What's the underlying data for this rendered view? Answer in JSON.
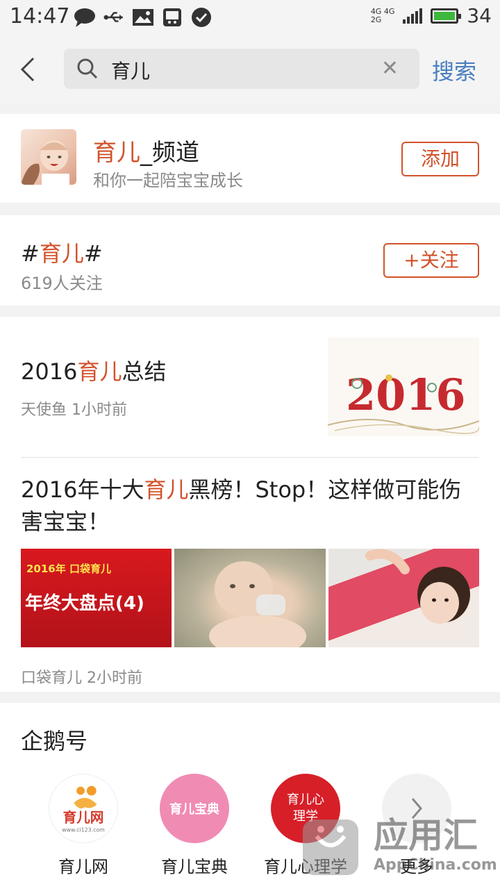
{
  "status_bar": {
    "time": "14:47",
    "net_top": "4G 4G",
    "net_bottom": "2G",
    "battery_level": "34"
  },
  "search": {
    "query": "育儿",
    "button_label": "搜索"
  },
  "channel": {
    "title_highlight": "育儿",
    "title_rest": "_频道",
    "subtitle": "和你一起陪宝宝成长",
    "add_label": "添加"
  },
  "topic": {
    "prefix": "#",
    "highlight": "育儿",
    "suffix": "#",
    "followers": "619人关注",
    "follow_label": "+关注"
  },
  "article1": {
    "title_pre": "2016",
    "title_highlight": "育儿",
    "title_post": "总结",
    "meta": "天使鱼  1小时前",
    "image_text": "2016"
  },
  "article2": {
    "title_pre": "2016年十大",
    "title_highlight": "育儿",
    "title_post": "黑榜！Stop！这样做可能伤害宝宝！",
    "img1_line1": "2016年  口袋育儿",
    "img1_line2": "年终大盘点(4)",
    "meta": "口袋育儿  2小时前"
  },
  "penguin": {
    "title": "企鹅号",
    "items": [
      {
        "label": "育儿网",
        "logo": "育儿网",
        "logo_sub": "www.ci123.com"
      },
      {
        "label": "育儿宝典",
        "logo": "育儿宝典"
      },
      {
        "label": "育儿心理学",
        "logo": "育儿心理学"
      },
      {
        "label": "更多"
      }
    ]
  },
  "watermark": {
    "brand": "应用汇",
    "url": "AppChina.com"
  },
  "colors": {
    "accent": "#d2522b",
    "link_blue": "#4a7fbf"
  }
}
